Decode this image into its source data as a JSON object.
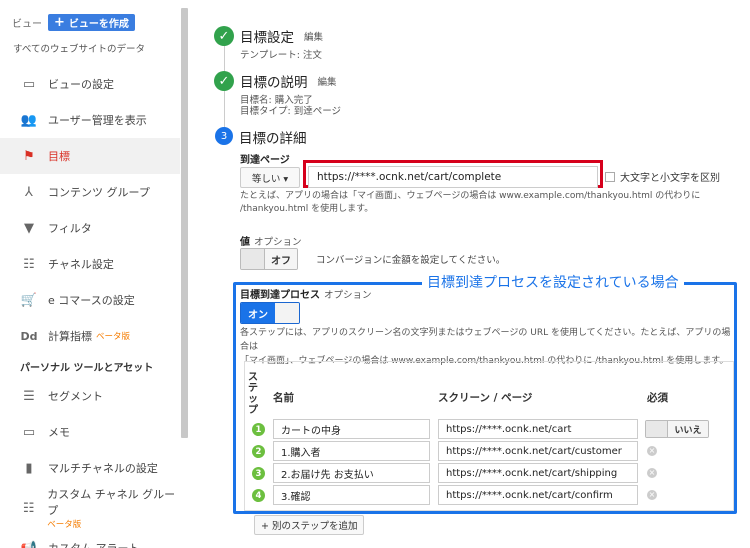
{
  "sidebar": {
    "view_label": "ビュー",
    "create_view_label": "ビューを作成",
    "all_data": "すべてのウェブサイトのデータ",
    "items": [
      {
        "label": "ビューの設定",
        "icon": "view-settings-icon"
      },
      {
        "label": "ユーザー管理を表示",
        "icon": "users-icon"
      },
      {
        "label": "目標",
        "icon": "flag-icon",
        "active": true
      },
      {
        "label": "コンテンツ グループ",
        "icon": "content-group-icon"
      },
      {
        "label": "フィルタ",
        "icon": "filter-icon"
      },
      {
        "label": "チャネル設定",
        "icon": "channel-icon"
      },
      {
        "label": "e コマースの設定",
        "icon": "cart-icon"
      },
      {
        "label": "計算指標",
        "icon": "calculated-metric-icon",
        "beta": "ベータ版"
      }
    ],
    "section_title": "パーソナル ツールとアセット",
    "personal_items": [
      {
        "label": "セグメント",
        "icon": "segment-icon"
      },
      {
        "label": "メモ",
        "icon": "memo-icon"
      },
      {
        "label": "マルチチャネルの設定",
        "icon": "multichannel-icon"
      },
      {
        "label": "カスタム チャネル グループ",
        "icon": "custom-channel-icon",
        "beta": "ベータ版"
      },
      {
        "label": "カスタム アラート",
        "icon": "alert-icon"
      }
    ]
  },
  "goal": {
    "step1": {
      "title": "目標設定",
      "edit": "編集",
      "sub": "テンプレート: 注文"
    },
    "step2": {
      "title": "目標の説明",
      "edit": "編集",
      "sub1": "目標名: 購入完了",
      "sub2": "目標タイプ: 到達ページ"
    },
    "step3": {
      "number": "3",
      "title": "目標の詳細"
    },
    "destination": {
      "label": "到達ページ",
      "match_type": "等しい ▾",
      "url": "https://****.ocnk.net/cart/complete",
      "case_sensitive": "大文字と小文字を区別",
      "hint": "たとえば、アプリの場合は「マイ画面」、ウェブページの場合は www.example.com/thankyou.html の代わりに /thankyou.html を使用します。"
    },
    "value": {
      "label": "値",
      "optional": "オプション",
      "toggle": "オフ",
      "text": "コンバージョンに金額を設定してください。"
    },
    "funnel": {
      "caption": "目標到達プロセスを設定されている場合",
      "label": "目標到達プロセス",
      "optional": "オプション",
      "toggle": "オン",
      "hint_line1": "各ステップには、アプリのスクリーン名の文字列またはウェブページの URL を使用してください。たとえば、アプリの場合は",
      "hint_line2": "「マイ画面」、ウェブページの場合は www.example.com/thankyou.html の代わりに /thankyou.html を使用します。",
      "col_step": "ステップ",
      "col_name": "名前",
      "col_page": "スクリーン / ページ",
      "col_required": "必須",
      "required_toggle": "いいえ",
      "steps": [
        {
          "num": "1",
          "name": "カートの中身",
          "url": "https://****.ocnk.net/cart"
        },
        {
          "num": "2",
          "name": "1.購入者",
          "url": "https://****.ocnk.net/cart/customer"
        },
        {
          "num": "3",
          "name": "2.お届け先 お支払い",
          "url": "https://****.ocnk.net/cart/shipping"
        },
        {
          "num": "4",
          "name": "3.確認",
          "url": "https://****.ocnk.net/cart/confirm"
        }
      ],
      "add_step": "+ 別のステップを追加"
    }
  },
  "colors": {
    "accent": "#1a73e8",
    "highlight_red": "#d6001c",
    "success": "#31a24c",
    "active_nav": "#d93025"
  }
}
